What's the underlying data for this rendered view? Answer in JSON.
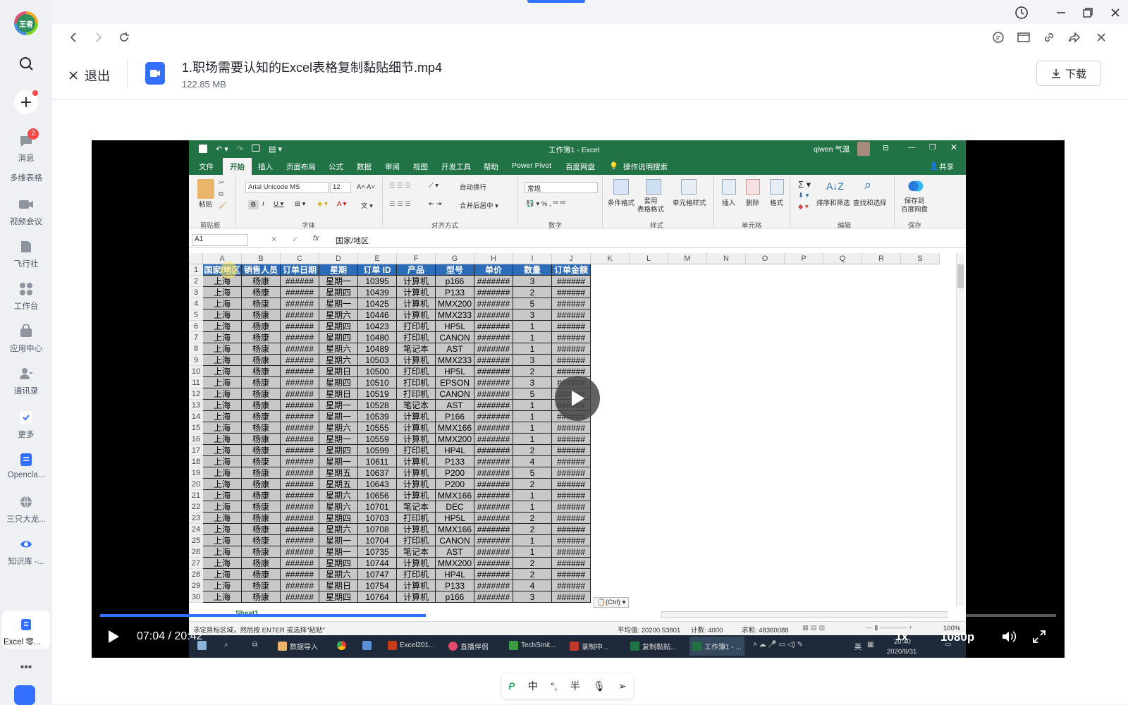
{
  "sidebar": {
    "avatar_text": "王者",
    "items": [
      {
        "label": "消息",
        "badge": "2"
      },
      {
        "label": "多维表格"
      },
      {
        "label": "视频会议"
      },
      {
        "label": "飞行社"
      },
      {
        "label": "工作台"
      },
      {
        "label": "应用中心"
      },
      {
        "label": "通讯录"
      },
      {
        "label": "更多"
      },
      {
        "label": "Opencla..."
      },
      {
        "label": "三只大龙..."
      },
      {
        "label": "知识库 -..."
      },
      {
        "label": "Excel 零..."
      }
    ]
  },
  "file": {
    "exit_label": "退出",
    "name": "1.职场需要认知的Excel表格复制黏贴细节.mp4",
    "size": "122.85 MB",
    "download_label": "下载"
  },
  "excel": {
    "window_title": "工作簿1 - Excel",
    "user": "qiwen 气温",
    "tabs": [
      "文件",
      "开始",
      "插入",
      "页面布局",
      "公式",
      "数据",
      "审阅",
      "视图",
      "开发工具",
      "帮助",
      "Power Pivot",
      "百度网盘",
      "操作说明搜索"
    ],
    "share": "共享",
    "ribbon": {
      "paste": "粘贴",
      "clipboard": "剪贴板",
      "font_name": "Arial Unicode MS",
      "font_size": "12",
      "font_group": "字体",
      "wrap": "自动换行",
      "merge": "合并后居中",
      "align_group": "对齐方式",
      "number_format": "常规",
      "number_group": "数字",
      "cond_format": "条件格式",
      "table_format": "套用\n表格格式",
      "cell_style": "单元格样式",
      "style_group": "样式",
      "insert": "插入",
      "delete": "删除",
      "format": "格式",
      "cells_group": "单元格",
      "sort_filter": "排序和筛选",
      "find_select": "查找和选择",
      "edit_group": "编辑",
      "save_baidu": "保存到\n百度网盘",
      "save_group": "保存"
    },
    "name_box": "A1",
    "formula": "国家/地区",
    "columns": [
      "A",
      "B",
      "C",
      "D",
      "E",
      "F",
      "G",
      "H",
      "I",
      "J",
      "K",
      "L",
      "M",
      "N",
      "O",
      "P",
      "Q",
      "R",
      "S"
    ],
    "headers": [
      "国家/地区",
      "销售人员",
      "订单日期",
      "星期",
      "订单 ID",
      "产品",
      "型号",
      "单价",
      "数量",
      "订单金额"
    ],
    "rows": [
      [
        "上海",
        "杨康",
        "######",
        "星期一",
        "10395",
        "计算机",
        "p166",
        "#######",
        "3",
        "######"
      ],
      [
        "上海",
        "杨康",
        "######",
        "星期四",
        "10439",
        "计算机",
        "P133",
        "#######",
        "2",
        "######"
      ],
      [
        "上海",
        "杨康",
        "######",
        "星期一",
        "10425",
        "计算机",
        "MMX200",
        "#######",
        "5",
        "######"
      ],
      [
        "上海",
        "杨康",
        "######",
        "星期六",
        "10446",
        "计算机",
        "MMX233",
        "#######",
        "3",
        "######"
      ],
      [
        "上海",
        "杨康",
        "######",
        "星期四",
        "10423",
        "打印机",
        "HP5L",
        "#######",
        "1",
        "######"
      ],
      [
        "上海",
        "杨康",
        "######",
        "星期四",
        "10480",
        "打印机",
        "CANON",
        "#######",
        "1",
        "######"
      ],
      [
        "上海",
        "杨康",
        "######",
        "星期六",
        "10489",
        "笔记本",
        "AST",
        "#######",
        "1",
        "######"
      ],
      [
        "上海",
        "杨康",
        "######",
        "星期六",
        "10503",
        "计算机",
        "MMX233",
        "#######",
        "3",
        "######"
      ],
      [
        "上海",
        "杨康",
        "######",
        "星期日",
        "10500",
        "打印机",
        "HP5L",
        "#######",
        "2",
        "######"
      ],
      [
        "上海",
        "杨康",
        "######",
        "星期四",
        "10510",
        "打印机",
        "EPSON",
        "#######",
        "3",
        "######"
      ],
      [
        "上海",
        "杨康",
        "######",
        "星期日",
        "10519",
        "打印机",
        "CANON",
        "#######",
        "5",
        "######"
      ],
      [
        "上海",
        "杨康",
        "######",
        "星期一",
        "10528",
        "笔记本",
        "AST",
        "#######",
        "1",
        "######"
      ],
      [
        "上海",
        "杨康",
        "######",
        "星期一",
        "10539",
        "计算机",
        "P166",
        "#######",
        "1",
        "######"
      ],
      [
        "上海",
        "杨康",
        "######",
        "星期六",
        "10555",
        "计算机",
        "MMX166",
        "#######",
        "1",
        "######"
      ],
      [
        "上海",
        "杨康",
        "######",
        "星期一",
        "10559",
        "计算机",
        "MMX200",
        "#######",
        "1",
        "######"
      ],
      [
        "上海",
        "杨康",
        "######",
        "星期四",
        "10599",
        "打印机",
        "HP4L",
        "#######",
        "2",
        "######"
      ],
      [
        "上海",
        "杨康",
        "######",
        "星期一",
        "10611",
        "计算机",
        "P133",
        "#######",
        "4",
        "######"
      ],
      [
        "上海",
        "杨康",
        "######",
        "星期五",
        "10637",
        "计算机",
        "P200",
        "#######",
        "5",
        "######"
      ],
      [
        "上海",
        "杨康",
        "######",
        "星期五",
        "10643",
        "计算机",
        "P200",
        "#######",
        "2",
        "######"
      ],
      [
        "上海",
        "杨康",
        "######",
        "星期六",
        "10656",
        "计算机",
        "MMX166",
        "#######",
        "1",
        "######"
      ],
      [
        "上海",
        "杨康",
        "######",
        "星期六",
        "10701",
        "笔记本",
        "DEC",
        "#######",
        "1",
        "######"
      ],
      [
        "上海",
        "杨康",
        "######",
        "星期四",
        "10703",
        "打印机",
        "HP5L",
        "#######",
        "2",
        "######"
      ],
      [
        "上海",
        "杨康",
        "######",
        "星期六",
        "10708",
        "计算机",
        "MMX166",
        "#######",
        "2",
        "######"
      ],
      [
        "上海",
        "杨康",
        "######",
        "星期一",
        "10704",
        "打印机",
        "CANON",
        "#######",
        "1",
        "######"
      ],
      [
        "上海",
        "杨康",
        "######",
        "星期一",
        "10735",
        "笔记本",
        "AST",
        "#######",
        "1",
        "######"
      ],
      [
        "上海",
        "杨康",
        "######",
        "星期四",
        "10744",
        "计算机",
        "MMX200",
        "#######",
        "2",
        "######"
      ],
      [
        "上海",
        "杨康",
        "######",
        "星期六",
        "10747",
        "打印机",
        "HP4L",
        "#######",
        "2",
        "######"
      ],
      [
        "上海",
        "杨康",
        "######",
        "星期日",
        "10754",
        "计算机",
        "P133",
        "#######",
        "4",
        "######"
      ],
      [
        "上海",
        "杨康",
        "######",
        "星期四",
        "10764",
        "计算机",
        "p166",
        "#######",
        "3",
        "######"
      ]
    ],
    "paste_ctrl": "(Ctrl)",
    "sheet_tab": "Sheet1",
    "status_left": "选定目标区域，然后按 ENTER 或选择\"粘贴\"",
    "status_avg": "平均值: 20200.53801",
    "status_count": "计数: 4000",
    "status_sum": "求和: 48360088",
    "zoom": "100%",
    "taskbar": [
      "数据导入",
      "Excel201...",
      "直播伴侣",
      "TechSmit...",
      "录制中...",
      "复制黏贴...",
      "工作簿1 - ..."
    ],
    "taskbar_lang": "英",
    "clock_time": "20:40",
    "clock_date": "2020/8/31"
  },
  "player": {
    "current": "07:04",
    "duration": "20:42",
    "progress": 0.3406,
    "speed": "1x",
    "quality": "1080p"
  },
  "ime": [
    "中",
    "°,",
    "半"
  ]
}
